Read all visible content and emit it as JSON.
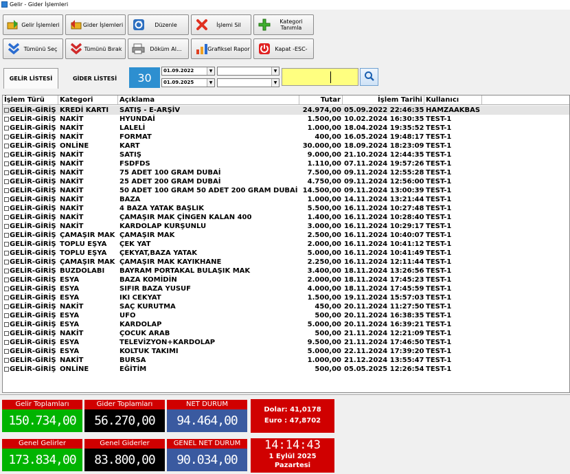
{
  "window": {
    "title": "Gelir - Gider İşlemleri"
  },
  "toolbar": {
    "gelir_label": "Gelir İşlemleri",
    "gider_label": "Gider İşlemleri",
    "duzenle_label": "Düzenle",
    "sil_label": "İşlemi Sil",
    "kategori_label": "Kategori Tanımla",
    "sec_label": "Tümünü Seç",
    "birak_label": "Tümünü Bırak",
    "dokum_label": "Döküm Al...",
    "grafik_label": "Grafiksel Rapor",
    "kapat_label": "Kapat -ESC-"
  },
  "tabs": {
    "gelir": "GELİR LİSTESİ",
    "gider": "GİDER LİSTESİ"
  },
  "filter": {
    "days": "30",
    "date_from": "01.09.2022",
    "date_to": "01.09.2025",
    "combo1": "",
    "combo2": "",
    "search_value": ""
  },
  "grid": {
    "headers": [
      "İşlem Türü",
      "Kategori",
      "Açıklama",
      "Tutar",
      "İşlem Tarihi",
      "Kullanıcı"
    ],
    "rows": [
      [
        "GELİR-GİRİŞ",
        "KREDİ KARTI",
        "SATIŞ - E-ARŞİV",
        "24.974,00",
        "05.09.2022 22:46:35",
        "HAMZAAKBAS"
      ],
      [
        "GELİR-GİRİŞ",
        "NAKİT",
        "HYUNDAİ",
        "1.500,00",
        "10.02.2024 16:30:35",
        "TEST-1"
      ],
      [
        "GELİR-GİRİŞ",
        "NAKİT",
        "LALELİ",
        "1.000,00",
        "18.04.2024 19:35:52",
        "TEST-1"
      ],
      [
        "GELİR-GİRİŞ",
        "NAKİT",
        "FORMAT",
        "400,00",
        "16.05.2024 19:48:17",
        "TEST-1"
      ],
      [
        "GELİR-GİRİŞ",
        "ONLİNE",
        "KART",
        "30.000,00",
        "18.09.2024 18:23:09",
        "TEST-1"
      ],
      [
        "GELİR-GİRİŞ",
        "NAKİT",
        "SATIŞ",
        "9.000,00",
        "21.10.2024 12:44:35",
        "TEST-1"
      ],
      [
        "GELİR-GİRİŞ",
        "NAKİT",
        "FSDFDS",
        "1.110,00",
        "07.11.2024 19:57:26",
        "TEST-1"
      ],
      [
        "GELİR-GİRİŞ",
        "NAKİT",
        "75 ADET 100 GRAM DUBAİ",
        "7.500,00",
        "09.11.2024 12:55:28",
        "TEST-1"
      ],
      [
        "GELİR-GİRİŞ",
        "NAKİT",
        "25 ADET 200 GRAM DUBAİ",
        "4.750,00",
        "09.11.2024 12:56:00",
        "TEST-1"
      ],
      [
        "GELİR-GİRİŞ",
        "NAKİT",
        "50 ADET 100 GRAM 50 ADET 200 GRAM DUBAİ",
        "14.500,00",
        "09.11.2024 13:00:39",
        "TEST-1"
      ],
      [
        "GELİR-GİRİŞ",
        "NAKİT",
        "BAZA",
        "1.000,00",
        "14.11.2024 13:21:44",
        "TEST-1"
      ],
      [
        "GELİR-GİRİŞ",
        "NAKİT",
        "4 BAZA YATAK BAŞLIK",
        "5.500,00",
        "16.11.2024 10:27:48",
        "TEST-1"
      ],
      [
        "GELİR-GİRİŞ",
        "NAKİT",
        "ÇAMAŞIR MAK ÇİNGEN KALAN 400",
        "1.400,00",
        "16.11.2024 10:28:40",
        "TEST-1"
      ],
      [
        "GELİR-GİRİŞ",
        "NAKİT",
        "KARDOLAP KURŞUNLU",
        "3.000,00",
        "16.11.2024 10:29:17",
        "TEST-1"
      ],
      [
        "GELİR-GİRİŞ",
        "ÇAMAŞIR MAK",
        "ÇAMAŞIR MAK",
        "2.500,00",
        "16.11.2024 10:40:07",
        "TEST-1"
      ],
      [
        "GELİR-GİRİŞ",
        "TOPLU EŞYA",
        "ÇEK YAT",
        "2.000,00",
        "16.11.2024 10:41:12",
        "TEST-1"
      ],
      [
        "GELİR-GİRİŞ",
        "TOPLU EŞYA",
        "ÇEKYAT,BAZA YATAK",
        "5.000,00",
        "16.11.2024 10:41:49",
        "TEST-1"
      ],
      [
        "GELİR-GİRİŞ",
        "ÇAMAŞIR MAK",
        "ÇAMAŞIR MAK KAYIKHANE",
        "2.250,00",
        "16.11.2024 12:11:44",
        "TEST-1"
      ],
      [
        "GELİR-GİRİŞ",
        "BUZDOLABI",
        "BAYRAM PORTAKAL BULAŞIK MAK",
        "3.400,00",
        "18.11.2024 13:26:56",
        "TEST-1"
      ],
      [
        "GELİR-GİRİŞ",
        "ESYA",
        "BAZA KOMİDİN",
        "2.000,00",
        "18.11.2024 17:45:23",
        "TEST-1"
      ],
      [
        "GELİR-GİRİŞ",
        "ESYA",
        "SIFIR BAZA YUSUF",
        "4.000,00",
        "18.11.2024 17:45:59",
        "TEST-1"
      ],
      [
        "GELİR-GİRİŞ",
        "ESYA",
        "IKI CEKYAT",
        "1.500,00",
        "19.11.2024 15:57:03",
        "TEST-1"
      ],
      [
        "GELİR-GİRİŞ",
        "NAKİT",
        "SAÇ KURUTMA",
        "450,00",
        "20.11.2024 11:27:50",
        "TEST-1"
      ],
      [
        "GELİR-GİRİŞ",
        "ESYA",
        "UFO",
        "500,00",
        "20.11.2024 16:38:35",
        "TEST-1"
      ],
      [
        "GELİR-GİRİŞ",
        "ESYA",
        "KARDOLAP",
        "5.000,00",
        "20.11.2024 16:39:21",
        "TEST-1"
      ],
      [
        "GELİR-GİRİŞ",
        "NAKİT",
        "ÇOCUK ARAB",
        "500,00",
        "21.11.2024 12:21:09",
        "TEST-1"
      ],
      [
        "GELİR-GİRİŞ",
        "ESYA",
        "TELEVİZYON+KARDOLAP",
        "9.500,00",
        "21.11.2024 17:46:50",
        "TEST-1"
      ],
      [
        "GELİR-GİRİŞ",
        "ESYA",
        "KOLTUK TAKIMI",
        "5.000,00",
        "22.11.2024 17:39:20",
        "TEST-1"
      ],
      [
        "GELİR-GİRİŞ",
        "NAKİT",
        "BURSA",
        "1.000,00",
        "21.12.2024 13:55:47",
        "TEST-1"
      ],
      [
        "GELİR-GİRİŞ",
        "ONLİNE",
        "EĞİTİM",
        "500,00",
        "05.05.2025 12:26:54",
        "TEST-1"
      ]
    ]
  },
  "totals": {
    "gelir_title": "Gelir Toplamları",
    "gelir_value": "150.734,00",
    "gider_title": "Gider Toplamları",
    "gider_value": "56.270,00",
    "net_title": "NET DURUM",
    "net_value": "94.464,00",
    "genel_gelir_title": "Genel Gelirler",
    "genel_gelir_value": "173.834,00",
    "genel_gider_title": "Genel Giderler",
    "genel_gider_value": "83.800,00",
    "genel_net_title": "GENEL NET DURUM",
    "genel_net_value": "90.034,00"
  },
  "rates": {
    "dolar": "Dolar: 41,0178",
    "euro": "Euro : 47,8702"
  },
  "clock": {
    "time": "14:14:43",
    "date": "1 Eylül 2025",
    "day": "Pazartesi"
  },
  "colors": {
    "green": "#00b400",
    "black": "#000000",
    "blue": "#3a5aa0",
    "red": "#d00000",
    "title_red": "#d00000",
    "accent": "#2d8fd0",
    "search_yellow": "#ffff80"
  }
}
